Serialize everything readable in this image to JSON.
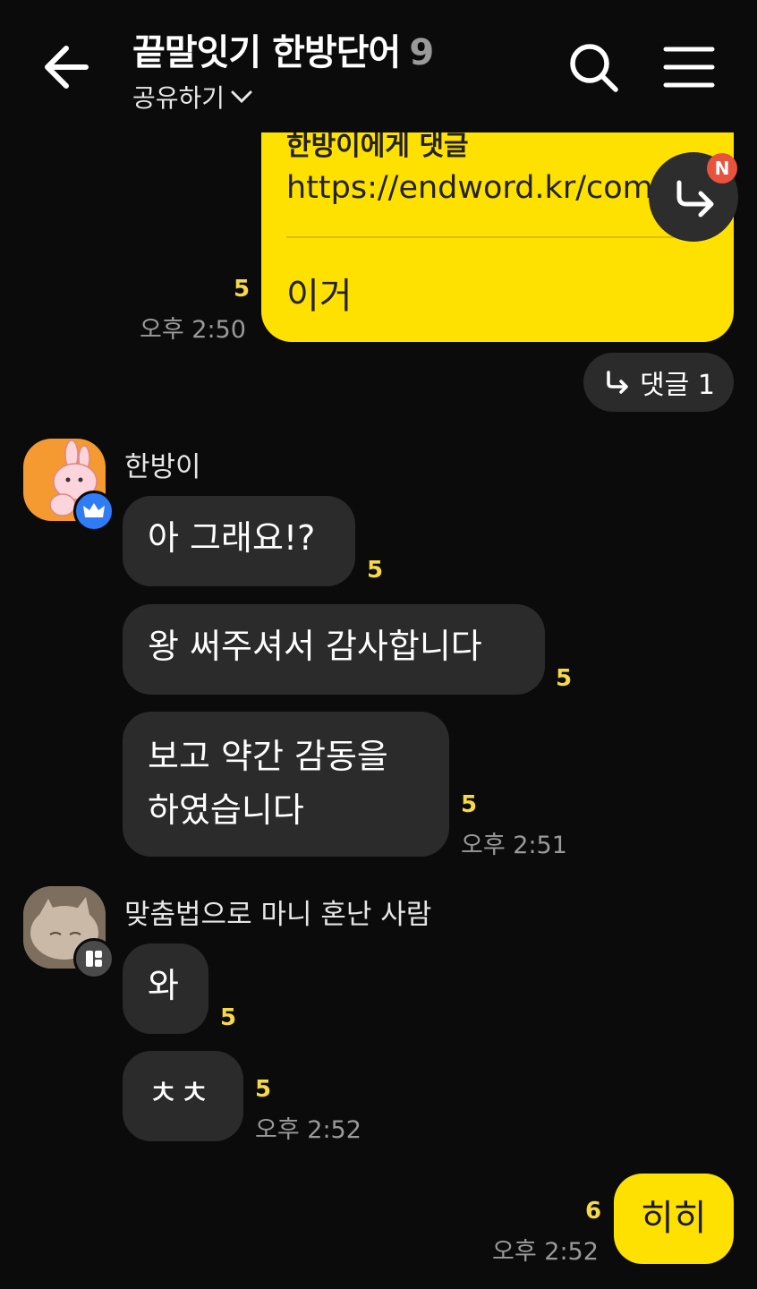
{
  "header": {
    "title": "끝말잇기 한방단어",
    "member_count": "9",
    "share_label": "공유하기"
  },
  "shared_post": {
    "title": "한방이에게 댓글",
    "link": "https://endword.kr/com",
    "body": "이거",
    "read_count": "5",
    "time": "오후 2:50",
    "reply_label": "댓글 1",
    "notification_badge": "N"
  },
  "messages": [
    {
      "sender": "한방이",
      "bubbles": [
        {
          "text": "아 그래요!?",
          "read": "5"
        },
        {
          "text": "왕 써주셔서 감사합니다",
          "read": "5"
        },
        {
          "text": "보고 약간 감동을",
          "text2": "하였습니다",
          "read": "5",
          "time": "오후 2:51"
        }
      ]
    },
    {
      "sender": "맞춤법으로 마니 혼난 사람",
      "bubbles": [
        {
          "text": "와",
          "read": "5"
        },
        {
          "text": "ㅊㅊ",
          "read": "5",
          "time": "오후 2:52"
        }
      ]
    }
  ],
  "my_message": {
    "text": "히히",
    "read": "6",
    "time": "오후 2:52"
  },
  "colors": {
    "accent_yellow": "#ffe100",
    "read_count": "#f6d94a",
    "bubble_dark": "#2b2b2b",
    "badge_red": "#e8533d",
    "crown_blue": "#2f7cf6"
  }
}
